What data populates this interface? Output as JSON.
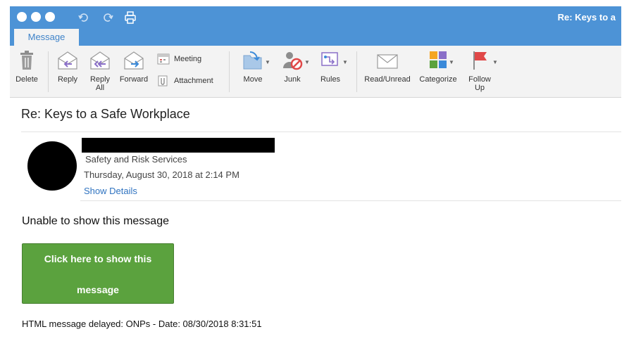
{
  "window": {
    "title": "Re: Keys to a",
    "active_tab": "Message"
  },
  "ribbon": {
    "delete": "Delete",
    "reply": "Reply",
    "reply_all_l1": "Reply",
    "reply_all_l2": "All",
    "forward": "Forward",
    "meeting": "Meeting",
    "attachment": "Attachment",
    "move": "Move",
    "junk": "Junk",
    "rules": "Rules",
    "read_unread": "Read/Unread",
    "categorize": "Categorize",
    "follow_up_l1": "Follow",
    "follow_up_l2": "Up"
  },
  "message": {
    "subject": "Re: Keys to a Safe Workplace",
    "sender_org": "Safety and Risk Services",
    "date": "Thursday, August 30, 2018 at 2:14 PM",
    "show_details": "Show Details",
    "unable_text": "Unable to show this message",
    "button_line1": "Click here to show this",
    "button_line2": "message",
    "delayed_text": "HTML message delayed: ONPs - Date: 08/30/2018 8:31:51"
  },
  "colors": {
    "titlebar": "#4d93d6",
    "ribbon_bg": "#f3f3f3",
    "link": "#2f73c0",
    "button_green": "#5ba23e",
    "follow_up_flag": "#e04848"
  }
}
